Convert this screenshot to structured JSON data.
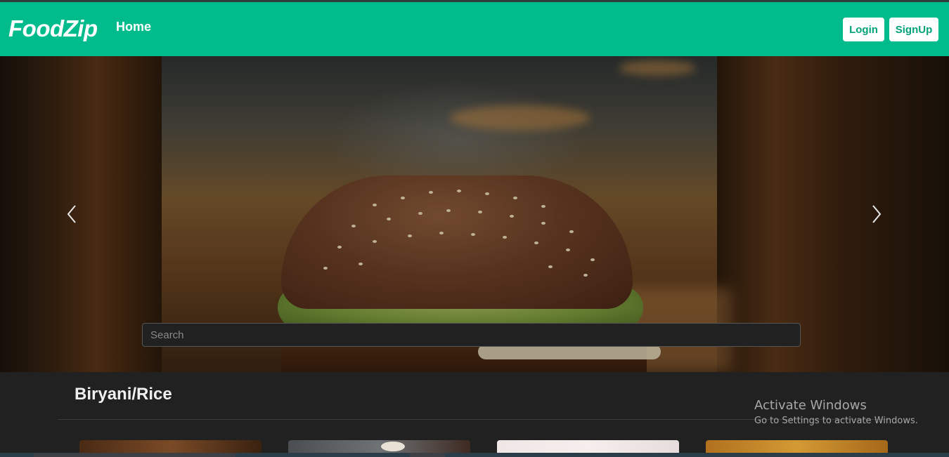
{
  "navbar": {
    "brand": "FoodZip",
    "home_label": "Home",
    "login_label": "Login",
    "signup_label": "SignUp"
  },
  "carousel": {
    "prev_icon": "chevron-left-icon",
    "next_icon": "chevron-right-icon"
  },
  "search": {
    "placeholder": "Search",
    "value": ""
  },
  "section": {
    "title": "Biryani/Rice"
  },
  "watermark": {
    "title": "Activate Windows",
    "subtitle": "Go to Settings to activate Windows."
  },
  "colors": {
    "brand": "#00bb8b",
    "background": "#212121"
  }
}
